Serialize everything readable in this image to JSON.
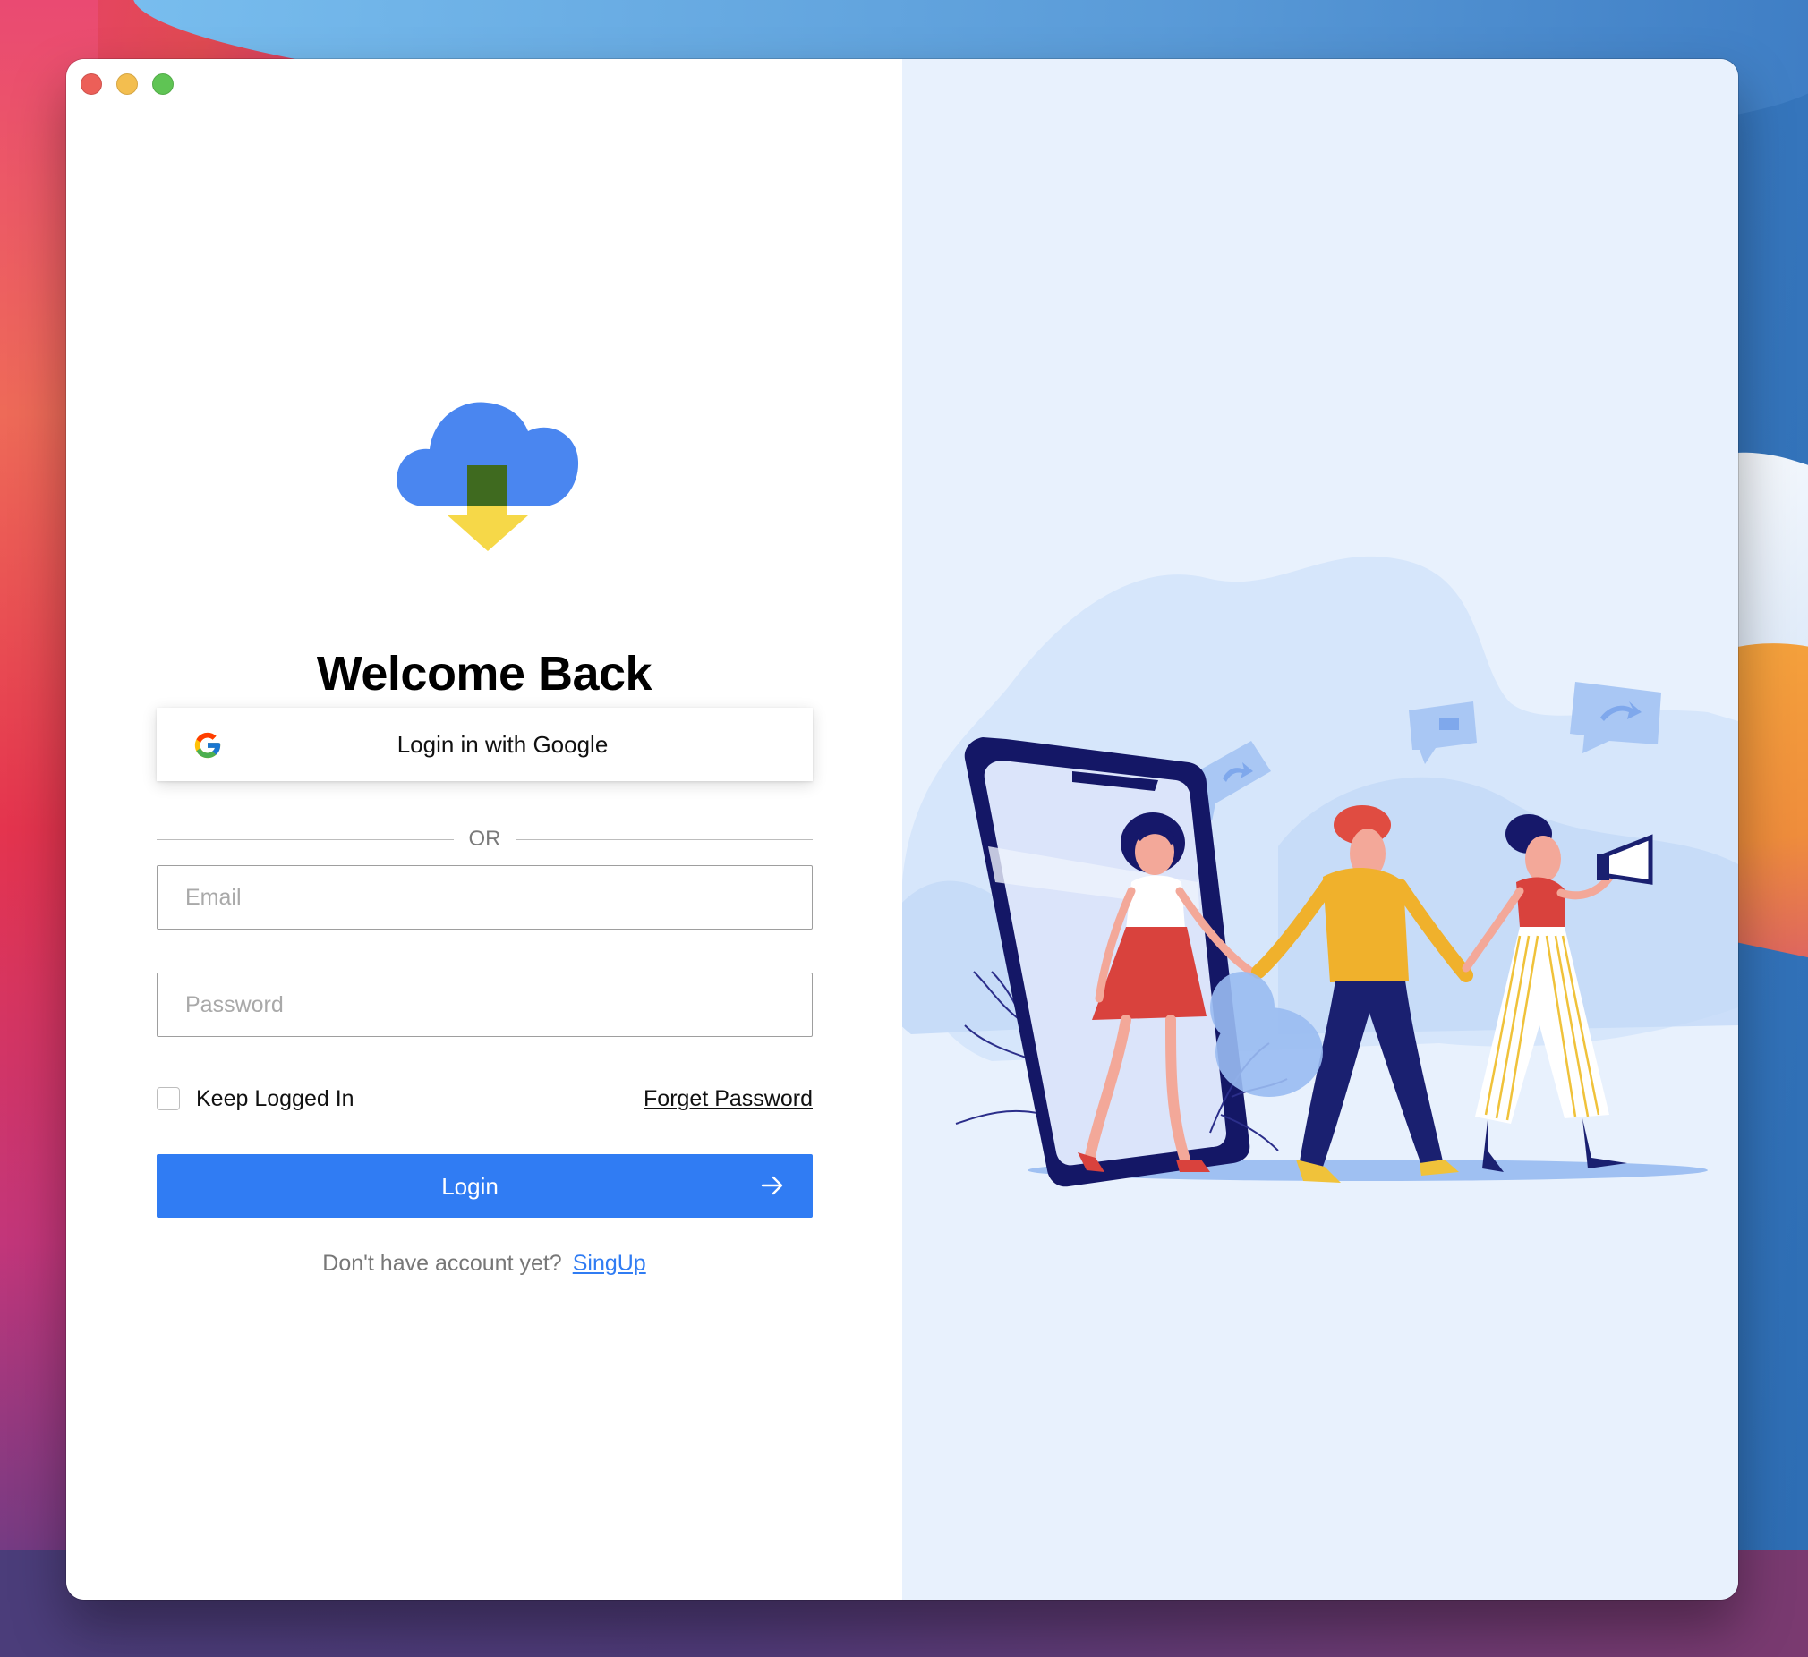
{
  "window": {
    "controls": [
      "close",
      "minimize",
      "zoom"
    ]
  },
  "login": {
    "title": "Welcome Back",
    "google_button_label": "Login in with Google",
    "separator": "OR",
    "email_placeholder": "Email",
    "email_value": "",
    "password_placeholder": "Password",
    "password_value": "",
    "keep_logged_in_label": "Keep Logged In",
    "keep_logged_in_checked": false,
    "forget_password_label": "Forget Password",
    "login_button_label": "Login",
    "signup_prompt": "Don't have account yet?",
    "signup_link": "SingUp"
  },
  "colors": {
    "accent": "#307cf3",
    "right_panel_bg": "#e8f1fd",
    "logo_cloud": "#4a86f0",
    "logo_arrow": "#f6d848",
    "logo_stem": "#3f6a1f"
  },
  "icons": {
    "logo": "cloud-download-icon",
    "google": "google-icon",
    "login_arrow": "arrow-right-icon",
    "illustration": "people-walking-from-phone-illustration"
  }
}
